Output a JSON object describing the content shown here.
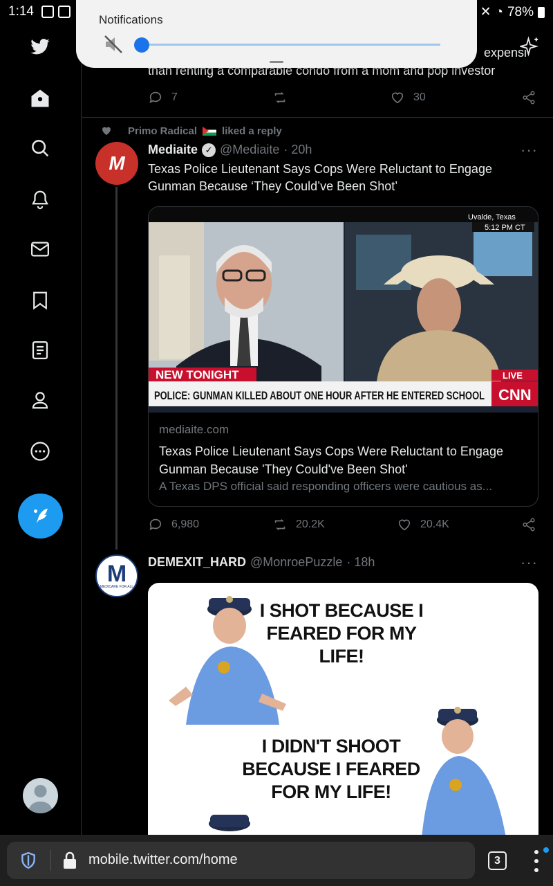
{
  "status_bar": {
    "time": "1:14",
    "battery": "78%"
  },
  "notification_panel": {
    "title": "Notifications",
    "volume_level": 0.0
  },
  "sidebar": {
    "items": [
      {
        "icon": "twitter-logo-icon"
      },
      {
        "icon": "home-icon"
      },
      {
        "icon": "search-icon"
      },
      {
        "icon": "bell-icon"
      },
      {
        "icon": "mail-icon"
      },
      {
        "icon": "bookmark-icon"
      },
      {
        "icon": "lists-icon"
      },
      {
        "icon": "profile-icon"
      },
      {
        "icon": "more-icon"
      }
    ],
    "compose_icon": "compose-tweet-icon"
  },
  "previous_tweet": {
    "text_fragment": "than renting a comparable condo from a mom and pop investor",
    "text_fragment_right": "expensi",
    "replies": "7",
    "likes": "30"
  },
  "tweet1": {
    "social_context": "Primo Radical",
    "social_context_suffix": "liked a reply",
    "name": "Mediaite",
    "handle": "@Mediaite",
    "time": "· 20h",
    "avatar_letter": "M",
    "text": "Texas Police Lieutenant Says Cops Were Reluctant to Engage Gunman Because ‘They Could’ve Been Shot’",
    "card": {
      "image_location": "Uvalde, Texas",
      "image_time": "5:12 PM CT",
      "image_tag": "NEW TONIGHT",
      "image_headline": "POLICE: GUNMAN KILLED ABOUT ONE HOUR AFTER HE ENTERED SCHOOL",
      "image_live": "LIVE",
      "image_network": "CNN",
      "domain": "mediaite.com",
      "title": "Texas Police Lieutenant Says Cops Were Reluctant to Engage Gunman Because 'They Could've Been Shot'",
      "description": "A Texas DPS official said responding officers were cautious as..."
    },
    "replies": "6,980",
    "retweets": "20.2K",
    "likes": "20.4K"
  },
  "tweet2": {
    "name": "DEMEXIT_HARD",
    "handle": "@MonroePuzzle",
    "time": "· 18h",
    "avatar_letter": "M",
    "avatar_caption": "MEDICARE FOR ALL",
    "meme_line1": "I SHOT BECAUSE I FEARED FOR MY LIFE!",
    "meme_line2": "I DIDN'T SHOOT BECAUSE I FEARED FOR MY LIFE!"
  },
  "browser": {
    "url": "mobile.twitter.com/home",
    "tab_count": "3"
  },
  "colors": {
    "accent": "#1d9bf0",
    "background": "#000000",
    "muted": "#71767b"
  }
}
